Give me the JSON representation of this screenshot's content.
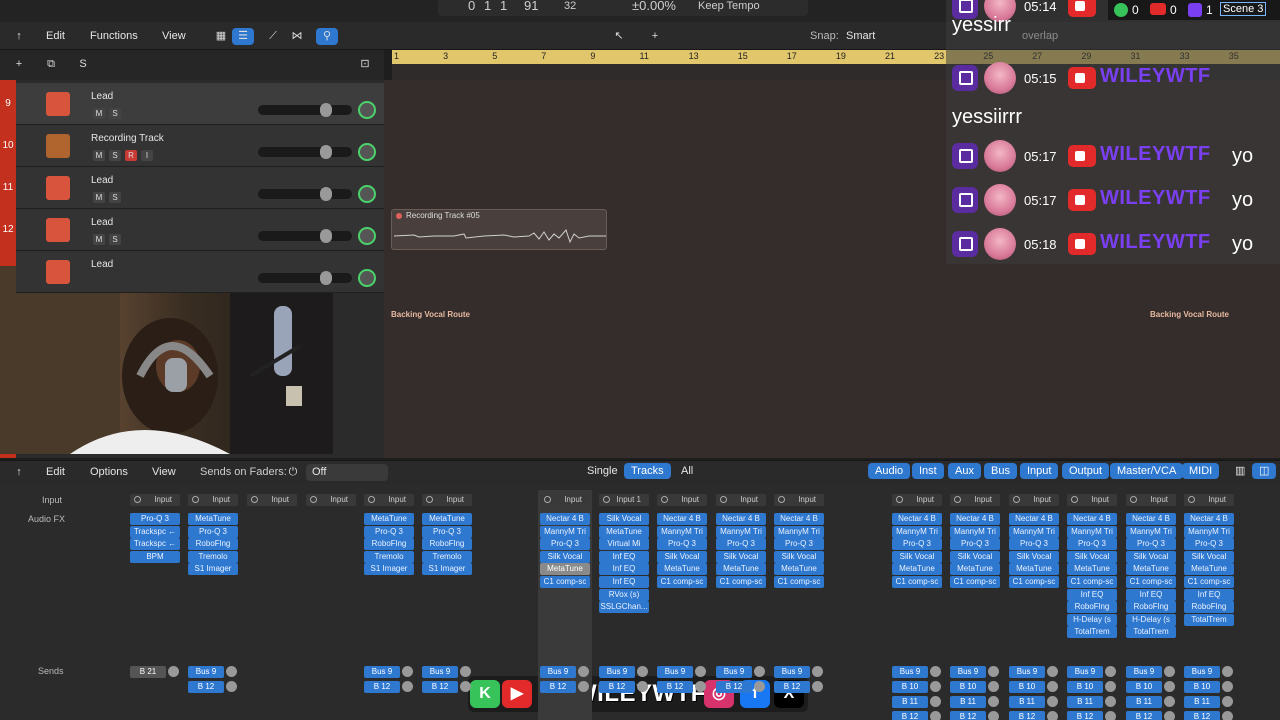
{
  "lcd": {
    "bar": "0",
    "beat": "1",
    "div": "1",
    "tick": "91",
    "ticks2": "32",
    "tempo_change": "±0.00%",
    "tempo_mode": "Keep Tempo"
  },
  "arrange_toolbar": {
    "edit": "Edit",
    "functions": "Functions",
    "view": "View",
    "snap_label": "Snap:",
    "snap_value": "Smart",
    "drag_value": "overlap"
  },
  "tracks_header": {
    "s_label": "S"
  },
  "ruler": {
    "marks": [
      "1",
      "3",
      "5",
      "7",
      "9",
      "11",
      "13",
      "15",
      "17",
      "19",
      "21",
      "23",
      "25",
      "27",
      "29",
      "31",
      "33",
      "35"
    ]
  },
  "tracks": [
    {
      "num": "9",
      "name": "Lead",
      "btns": [
        "M",
        "S"
      ]
    },
    {
      "num": "10",
      "name": "Recording Track",
      "btns": [
        "M",
        "S",
        "R",
        "I"
      ]
    },
    {
      "num": "11",
      "name": "Lead",
      "btns": [
        "M",
        "S"
      ]
    },
    {
      "num": "12",
      "name": "Lead",
      "btns": [
        "M",
        "S"
      ]
    },
    {
      "num": "",
      "name": "Lead",
      "btns": []
    }
  ],
  "region": {
    "name": "Recording Track #05"
  },
  "markers": {
    "left": "Backing Vocal Route",
    "right": "Backing Vocal Route"
  },
  "chat": {
    "messages": [
      {
        "time": "05:14",
        "user": "",
        "text": "yessirr"
      },
      {
        "time": "05:15",
        "user": "WILEYWTF",
        "text": "yessiirrr"
      },
      {
        "time": "05:17",
        "user": "WILEYWTF",
        "text": "yo"
      },
      {
        "time": "05:17",
        "user": "WILEYWTF",
        "text": "yo"
      },
      {
        "time": "05:18",
        "user": "WILEYWTF",
        "text": "yo"
      }
    ]
  },
  "stream_stats": {
    "kick": "0",
    "youtube": "0",
    "twitch": "1",
    "scene": "Scene 3"
  },
  "mixer_toolbar": {
    "edit": "Edit",
    "options": "Options",
    "view": "View",
    "sends_on_faders": "Sends on Faders:",
    "sends_value": "Off",
    "modes": [
      "Single",
      "Tracks",
      "All"
    ],
    "filters": [
      "Audio",
      "Inst",
      "Aux",
      "Bus",
      "Input",
      "Output",
      "Master/VCA",
      "MIDI"
    ]
  },
  "mixer_labels": {
    "input": "Input",
    "audio_fx": "Audio FX",
    "sends": "Sends"
  },
  "strips": [
    {
      "input": "Input",
      "fx": [
        "Pro-Q 3",
        "Trackspc ←",
        "Trackspc ←",
        "BPM"
      ],
      "sends": [
        "B 21"
      ],
      "grey_send": true
    },
    {
      "input": "Input",
      "fx": [
        "MetaTune",
        "Pro-Q 3",
        "RoboFlng",
        "Tremolo",
        "S1 Imager"
      ],
      "sends": [
        "Bus 9",
        "B 12"
      ]
    },
    {
      "input": "Input",
      "fx": [],
      "sends": []
    },
    {
      "input": "Input",
      "fx": [],
      "sends": []
    },
    {
      "input": "Input",
      "fx": [
        "MetaTune",
        "Pro-Q 3",
        "RoboFlng",
        "Tremolo",
        "S1 Imager"
      ],
      "sends": [
        "Bus 9",
        "B 12"
      ]
    },
    {
      "input": "Input",
      "fx": [
        "MetaTune",
        "Pro-Q 3",
        "RoboFlng",
        "Tremolo",
        "S1 Imager"
      ],
      "sends": [
        "Bus 9",
        "B 12"
      ]
    },
    {
      "input": "Input",
      "fx": [
        "Nectar 4 B",
        "MannyM Tri",
        "Pro-Q 3",
        "Silk Vocal",
        "MetaTune",
        "C1 comp-sc"
      ],
      "sends": [
        "Bus 9",
        "B 12"
      ]
    },
    {
      "input": "Input 1",
      "fx": [
        "Silk Vocal",
        "MetaTune",
        "Virtual Mi",
        "Inf EQ",
        "Inf EQ",
        "Inf EQ",
        "RVox (s)",
        "SSLGChan..."
      ],
      "sends": [
        "Bus 9",
        "B 12"
      ]
    },
    {
      "input": "Input",
      "fx": [
        "Nectar 4 B",
        "MannyM Tri",
        "Pro-Q 3",
        "Silk Vocal",
        "MetaTune",
        "C1 comp-sc"
      ],
      "sends": [
        "Bus 9",
        "B 12"
      ]
    },
    {
      "input": "Input",
      "fx": [
        "Nectar 4 B",
        "MannyM Tri",
        "Pro-Q 3",
        "Silk Vocal",
        "MetaTune",
        "C1 comp-sc"
      ],
      "sends": [
        "Bus 9",
        "B 12"
      ]
    },
    {
      "input": "Input",
      "fx": [
        "Nectar 4 B",
        "MannyM Tri",
        "Pro-Q 3",
        "Silk Vocal",
        "MetaTune",
        "C1 comp-sc"
      ],
      "sends": [
        "Bus 9",
        "B 12"
      ]
    },
    {
      "input": "Input",
      "fx": [
        "Nectar 4 B",
        "MannyM Tri",
        "Pro-Q 3",
        "Silk Vocal",
        "MetaTune",
        "C1 comp-sc"
      ],
      "sends": [
        "Bus 9",
        "B 10",
        "B 11",
        "B 12"
      ]
    },
    {
      "input": "Input",
      "fx": [
        "Nectar 4 B",
        "MannyM Tri",
        "Pro-Q 3",
        "Silk Vocal",
        "MetaTune",
        "C1 comp-sc"
      ],
      "sends": [
        "Bus 9",
        "B 10",
        "B 11",
        "B 12"
      ]
    },
    {
      "input": "Input",
      "fx": [
        "Nectar 4 B",
        "MannyM Tri",
        "Pro-Q 3",
        "Silk Vocal",
        "MetaTune",
        "C1 comp-sc"
      ],
      "sends": [
        "Bus 9",
        "B 10",
        "B 11",
        "B 12"
      ]
    },
    {
      "input": "Input",
      "fx": [
        "Nectar 4 B",
        "MannyM Tri",
        "Pro-Q 3",
        "Silk Vocal",
        "MetaTune",
        "C1 comp-sc",
        "Inf EQ",
        "RoboFlng",
        "H-Delay (s",
        "TotalTrem"
      ],
      "sends": [
        "Bus 9",
        "B 10",
        "B 11",
        "B 12"
      ]
    },
    {
      "input": "Input",
      "fx": [
        "Nectar 4 B",
        "MannyM Tri",
        "Pro-Q 3",
        "Silk Vocal",
        "MetaTune",
        "C1 comp-sc",
        "Inf EQ",
        "RoboFlng",
        "H-Delay (s",
        "TotalTrem"
      ],
      "sends": [
        "Bus 9",
        "B 10",
        "B 11",
        "B 12"
      ]
    },
    {
      "input": "Input",
      "fx": [
        "Nectar 4 B",
        "MannyM Tri",
        "Pro-Q 3",
        "Silk Vocal",
        "MetaTune",
        "C1 comp-sc",
        "Inf EQ",
        "RoboFlng",
        "TotalTrem"
      ],
      "sends": [
        "Bus 9",
        "B 10",
        "B 11",
        "B 12"
      ]
    }
  ],
  "banner": {
    "name": "WILEYWTF",
    "icons": [
      "kick-icon",
      "youtube-icon",
      "twitch-icon",
      "instagram-icon",
      "facebook-icon",
      "x-icon"
    ]
  }
}
